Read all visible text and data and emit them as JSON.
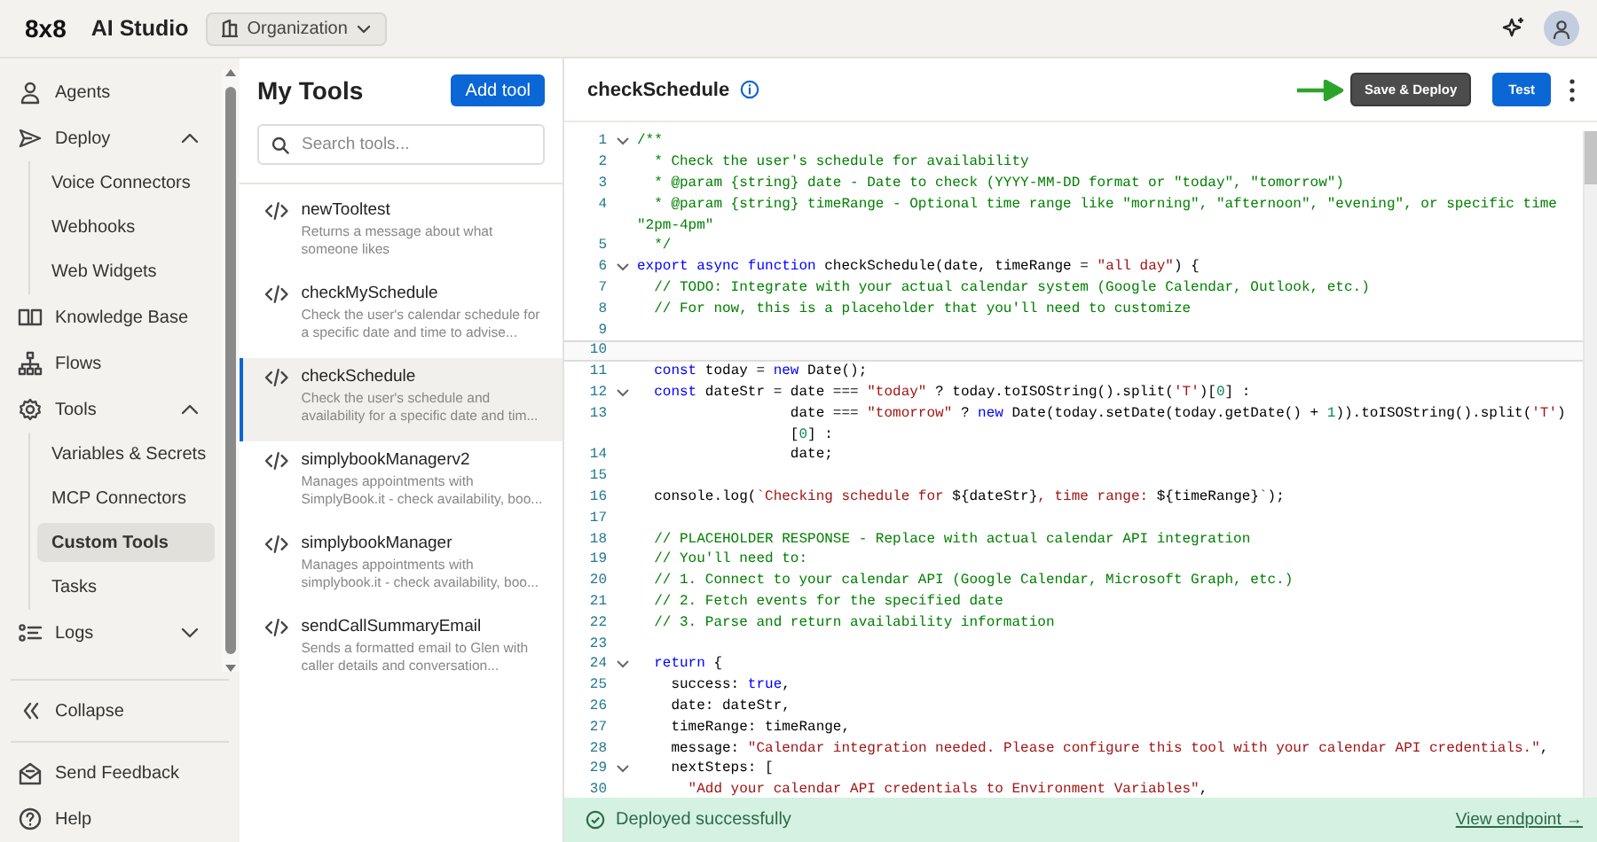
{
  "header": {
    "logo": "8x8",
    "product": "AI Studio",
    "workspace": "Organization"
  },
  "sidebar": {
    "items": [
      {
        "label": "Agents",
        "selected": false
      },
      {
        "label": "Deploy",
        "selected": false,
        "expanded": true,
        "children": [
          {
            "label": "Voice Connectors",
            "selected": false
          },
          {
            "label": "Webhooks",
            "selected": false
          },
          {
            "label": "Web Widgets",
            "selected": false
          }
        ]
      },
      {
        "label": "Knowledge Base",
        "selected": false
      },
      {
        "label": "Flows",
        "selected": false
      },
      {
        "label": "Tools",
        "selected": false,
        "expanded": true,
        "children": [
          {
            "label": "Variables & Secrets",
            "selected": false
          },
          {
            "label": "MCP Connectors",
            "selected": false
          },
          {
            "label": "Custom Tools",
            "selected": true
          },
          {
            "label": "Tasks",
            "selected": false
          }
        ]
      },
      {
        "label": "Logs",
        "selected": false,
        "expanded": false
      }
    ],
    "footer": [
      {
        "label": "Collapse"
      },
      {
        "label": "Send Feedback"
      },
      {
        "label": "Help"
      }
    ]
  },
  "tools_panel": {
    "title": "My Tools",
    "add_button": "Add tool",
    "search": {
      "placeholder": "Search tools..."
    },
    "tools": [
      {
        "name": "newTooltest",
        "description": "Returns a message about what someone likes",
        "selected": false
      },
      {
        "name": "checkMySchedule",
        "description": "Check the user's calendar schedule for a specific date and time to advise...",
        "selected": false
      },
      {
        "name": "checkSchedule",
        "description": "Check the user's schedule and availability for a specific date and tim...",
        "selected": true
      },
      {
        "name": "simplybookManagerv2",
        "description": "Manages appointments with SimplyBook.it - check availability, boo...",
        "selected": false
      },
      {
        "name": "simplybookManager",
        "description": "Manages appointments with simplybook.it - check availability, boo...",
        "selected": false
      },
      {
        "name": "sendCallSummaryEmail",
        "description": "Sends a formatted email to Glen with caller details and conversation...",
        "selected": false
      }
    ]
  },
  "editor": {
    "title": "checkSchedule",
    "save_button": "Save & Deploy",
    "test_button": "Test",
    "lines": [
      {
        "number": "1",
        "fold": true,
        "current": false,
        "tokens": [
          {
            "kind": "comment",
            "text": "/**"
          }
        ]
      },
      {
        "number": "2",
        "fold": false,
        "current": false,
        "tokens": [
          {
            "kind": "comment",
            "text": "  * Check the user's schedule for availability"
          }
        ]
      },
      {
        "number": "3",
        "fold": false,
        "current": false,
        "tokens": [
          {
            "kind": "comment",
            "text": "  * @param {string} date - Date to check (YYYY-MM-DD format or \"today\", \"tomorrow\")"
          }
        ]
      },
      {
        "number": "4",
        "fold": false,
        "current": false,
        "tokens": [
          {
            "kind": "comment",
            "text": "  * @param {string} timeRange - Optional time range like \"morning\", \"afternoon\", \"evening\", or specific time"
          }
        ]
      },
      {
        "fold": false,
        "current": false,
        "tokens": [
          {
            "kind": "comment",
            "text": "\"2pm-4pm\""
          }
        ]
      },
      {
        "number": "5",
        "fold": false,
        "current": false,
        "tokens": [
          {
            "kind": "comment",
            "text": "  */"
          }
        ]
      },
      {
        "number": "6",
        "fold": true,
        "current": false,
        "tokens": [
          {
            "kind": "keyword",
            "text": "export async function"
          },
          {
            "kind": "plain",
            "text": " checkSchedule(date, timeRange = "
          },
          {
            "kind": "string",
            "text": "\"all day\""
          },
          {
            "kind": "plain",
            "text": ") {"
          }
        ]
      },
      {
        "number": "7",
        "fold": false,
        "current": false,
        "tokens": [
          {
            "kind": "comment",
            "text": "  // TODO: Integrate with your actual calendar system (Google Calendar, Outlook, etc.)"
          }
        ]
      },
      {
        "number": "8",
        "fold": false,
        "current": false,
        "tokens": [
          {
            "kind": "comment",
            "text": "  // For now, this is a placeholder that you'll need to customize"
          }
        ]
      },
      {
        "number": "9",
        "fold": false,
        "current": false
      },
      {
        "number": "10",
        "fold": false,
        "current": true
      },
      {
        "number": "11",
        "fold": false,
        "current": false,
        "tokens": [
          {
            "kind": "keyword",
            "text": "  const"
          },
          {
            "kind": "plain",
            "text": " today = "
          },
          {
            "kind": "keyword",
            "text": "new"
          },
          {
            "kind": "plain",
            "text": " Date();"
          }
        ]
      },
      {
        "number": "12",
        "fold": true,
        "current": false,
        "tokens": [
          {
            "kind": "keyword",
            "text": "  const"
          },
          {
            "kind": "plain",
            "text": " dateStr = date === "
          },
          {
            "kind": "string",
            "text": "\"today\""
          },
          {
            "kind": "plain",
            "text": " ? today.toISOString().split("
          },
          {
            "kind": "string",
            "text": "'T'"
          },
          {
            "kind": "plain",
            "text": ")["
          },
          {
            "kind": "number",
            "text": "0"
          },
          {
            "kind": "plain",
            "text": "] :"
          }
        ]
      },
      {
        "number": "13",
        "fold": false,
        "current": false,
        "tokens": [
          {
            "kind": "plain",
            "text": "                  date === "
          },
          {
            "kind": "string",
            "text": "\"tomorrow\""
          },
          {
            "kind": "plain",
            "text": " ? "
          },
          {
            "kind": "keyword",
            "text": "new"
          },
          {
            "kind": "plain",
            "text": " Date(today.setDate(today.getDate() + "
          },
          {
            "kind": "number",
            "text": "1"
          },
          {
            "kind": "plain",
            "text": ")).toISOString().split("
          },
          {
            "kind": "string",
            "text": "'T'"
          },
          {
            "kind": "plain",
            "text": ")"
          }
        ]
      },
      {
        "fold": false,
        "current": false,
        "tokens": [
          {
            "kind": "plain",
            "text": "                  ["
          },
          {
            "kind": "number",
            "text": "0"
          },
          {
            "kind": "plain",
            "text": "] :"
          }
        ]
      },
      {
        "number": "14",
        "fold": false,
        "current": false,
        "tokens": [
          {
            "kind": "plain",
            "text": "                  date;"
          }
        ]
      },
      {
        "number": "15",
        "fold": false,
        "current": false
      },
      {
        "number": "16",
        "fold": false,
        "current": false,
        "tokens": [
          {
            "kind": "plain",
            "text": "  console.log("
          },
          {
            "kind": "string",
            "text": "`Checking schedule for "
          },
          {
            "kind": "plain",
            "text": "${dateStr}"
          },
          {
            "kind": "string",
            "text": ", time range: "
          },
          {
            "kind": "plain",
            "text": "${timeRange}"
          },
          {
            "kind": "string",
            "text": "`"
          },
          {
            "kind": "plain",
            "text": ");"
          }
        ]
      },
      {
        "number": "17",
        "fold": false,
        "current": false
      },
      {
        "number": "18",
        "fold": false,
        "current": false,
        "tokens": [
          {
            "kind": "comment",
            "text": "  // PLACEHOLDER RESPONSE - Replace with actual calendar API integration"
          }
        ]
      },
      {
        "number": "19",
        "fold": false,
        "current": false,
        "tokens": [
          {
            "kind": "comment",
            "text": "  // You'll need to:"
          }
        ]
      },
      {
        "number": "20",
        "fold": false,
        "current": false,
        "tokens": [
          {
            "kind": "comment",
            "text": "  // 1. Connect to your calendar API (Google Calendar, Microsoft Graph, etc.)"
          }
        ]
      },
      {
        "number": "21",
        "fold": false,
        "current": false,
        "tokens": [
          {
            "kind": "comment",
            "text": "  // 2. Fetch events for the specified date"
          }
        ]
      },
      {
        "number": "22",
        "fold": false,
        "current": false,
        "tokens": [
          {
            "kind": "comment",
            "text": "  // 3. Parse and return availability information"
          }
        ]
      },
      {
        "number": "23",
        "fold": false,
        "current": false
      },
      {
        "number": "24",
        "fold": true,
        "current": false,
        "tokens": [
          {
            "kind": "keyword",
            "text": "  return"
          },
          {
            "kind": "plain",
            "text": " {"
          }
        ]
      },
      {
        "number": "25",
        "fold": false,
        "current": false,
        "tokens": [
          {
            "kind": "plain",
            "text": "    success: "
          },
          {
            "kind": "keyword",
            "text": "true"
          },
          {
            "kind": "plain",
            "text": ","
          }
        ]
      },
      {
        "number": "26",
        "fold": false,
        "current": false,
        "tokens": [
          {
            "kind": "plain",
            "text": "    date: dateStr,"
          }
        ]
      },
      {
        "number": "27",
        "fold": false,
        "current": false,
        "tokens": [
          {
            "kind": "plain",
            "text": "    timeRange: timeRange,"
          }
        ]
      },
      {
        "number": "28",
        "fold": false,
        "current": false,
        "tokens": [
          {
            "kind": "plain",
            "text": "    message: "
          },
          {
            "kind": "string",
            "text": "\"Calendar integration needed. Please configure this tool with your calendar API credentials.\""
          },
          {
            "kind": "plain",
            "text": ","
          }
        ]
      },
      {
        "number": "29",
        "fold": true,
        "current": false,
        "tokens": [
          {
            "kind": "plain",
            "text": "    nextSteps: ["
          }
        ]
      },
      {
        "number": "30",
        "fold": false,
        "current": false,
        "tokens": [
          {
            "kind": "string",
            "text": "      \"Add your calendar API credentials to Environment Variables\""
          },
          {
            "kind": "plain",
            "text": ","
          }
        ]
      }
    ]
  },
  "toast": {
    "message": "Deployed successfully",
    "link": "View endpoint →"
  }
}
